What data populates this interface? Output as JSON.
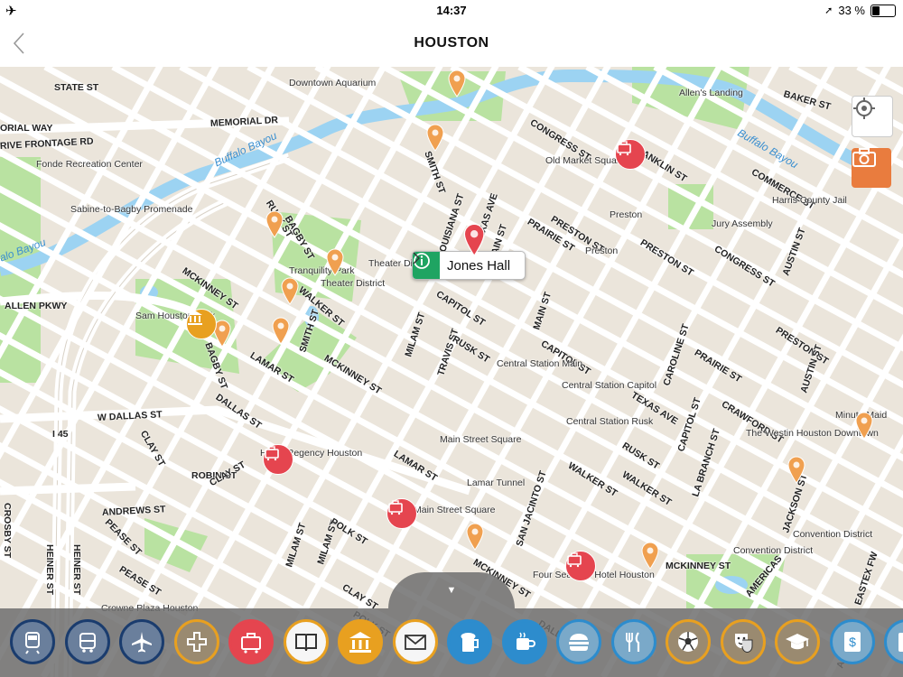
{
  "status_bar": {
    "time": "14:37",
    "battery": "33 %",
    "battery_level": 0.33
  },
  "nav": {
    "title": "HOUSTON",
    "back_icon": "chevron-left-icon"
  },
  "map": {
    "selected_place": "Jones Hall",
    "water_labels": [
      "Buffalo Bayou",
      "Buffalo Bayou",
      "alo Bayou"
    ],
    "street_labels": [
      "STATE ST",
      "MEMORIAL DR",
      "ORIAL WAY",
      "RIVE FRONTAGE RD",
      "RUSK ST",
      "BAGBY ST",
      "MCKINNEY ST",
      "WALKER ST",
      "ALLEN PKWY",
      "BAGBY ST",
      "LAMAR ST",
      "DALLAS ST",
      "SMITH ST",
      "MCKINNEY ST",
      "W DALLAS ST",
      "I 45",
      "CLAY ST",
      "ROBIN ST",
      "CLAY ST",
      "PEASE ST",
      "ANDREWS ST",
      "CROSBY ST",
      "HEINER ST",
      "HEINER ST",
      "PEASE ST",
      "MILAM ST",
      "MILAM ST",
      "POLK ST",
      "LAMAR ST",
      "MCKINNEY ST",
      "MILAM ST",
      "TRAVIS ST",
      "RUSK ST",
      "CAPITOL ST",
      "TEXAS AVE",
      "LOUISIANA ST",
      "SMITH ST",
      "MAIN ST",
      "MAIN ST",
      "PRAIRIE ST",
      "PRESTON ST",
      "CONGRESS ST",
      "FRANKLIN ST",
      "BAKER ST",
      "COMMERCE ST",
      "PRESTON ST",
      "CONGRESS ST",
      "AUSTIN ST",
      "PRAIRIE ST",
      "CAPITOL ST",
      "CAROLINE ST",
      "TEXAS AVE",
      "CRAWFORD ST",
      "PRESTON ST",
      "AUSTIN ST",
      "CAPITOL ST",
      "RUSK ST",
      "LA BRANCH ST",
      "WALKER ST",
      "WALKER ST",
      "SAN JACINTO ST",
      "JACKSON ST",
      "MCKINNEY ST",
      "DALLAS ST",
      "CLAY ST",
      "POLK ST",
      "AMERICAS",
      "EASTEX FW",
      "ARTRES"
    ],
    "poi_labels": [
      "Downtown Aquarium",
      "Fonde Recreation Center",
      "Sabine-to-Bagby Promenade",
      "Tranquility Park",
      "Theater District",
      "Theater District",
      "Sam Houston Park",
      "Hilton Regency Houston",
      "Lamar Tunnel",
      "Main Street Square",
      "Central Station Main",
      "Central Station Capitol",
      "Central Station Rusk",
      "Main Street Square",
      "Four Seasons Hotel Houston",
      "Crowne Plaza Houston",
      "Old Market Square",
      "Allen's Landing",
      "Harris County Jail",
      "Jury Assembly",
      "Preston",
      "Preston",
      "The Westin Houston Downtown",
      "Minute Maid",
      "Convention District",
      "Convention District"
    ]
  },
  "buttons": {
    "locate_icon": "crosshair-icon",
    "camera_icon": "camera-icon",
    "expand_icon": "triangle-down-icon"
  },
  "categories": [
    {
      "name": "train",
      "icon": "train-icon",
      "color": "#1a3c6e",
      "ring": "#1a3c6e"
    },
    {
      "name": "bus",
      "icon": "bus-icon",
      "color": "#1a3c6e",
      "ring": "#1a3c6e"
    },
    {
      "name": "airport",
      "icon": "plane-icon",
      "color": "#1a3c6e",
      "ring": "#1a3c6e"
    },
    {
      "name": "health",
      "icon": "medical-cross-icon",
      "color": "#e8a020",
      "ring": "#e8a020"
    },
    {
      "name": "hotels",
      "icon": "luggage-icon",
      "color": "#e5454f",
      "ring": "#e5454f"
    },
    {
      "name": "books",
      "icon": "book-icon",
      "color": "#e8a020",
      "ring": "#e8a020"
    },
    {
      "name": "museums",
      "icon": "museum-icon",
      "color": "#e8a020",
      "ring": "#e8a020"
    },
    {
      "name": "mail",
      "icon": "envelope-icon",
      "color": "#e8a020",
      "ring": "#e8a020"
    },
    {
      "name": "bars",
      "icon": "beer-mug-icon",
      "color": "#2d8ccd",
      "ring": "#2d8ccd"
    },
    {
      "name": "cafes",
      "icon": "coffee-cup-icon",
      "color": "#2d8ccd",
      "ring": "#2d8ccd"
    },
    {
      "name": "fast-food",
      "icon": "burger-icon",
      "color": "#2d8ccd",
      "ring": "#2d8ccd"
    },
    {
      "name": "restaurants",
      "icon": "fork-knife-icon",
      "color": "#2d8ccd",
      "ring": "#2d8ccd"
    },
    {
      "name": "sports",
      "icon": "soccer-ball-icon",
      "color": "#e8a020",
      "ring": "#e8a020"
    },
    {
      "name": "theater",
      "icon": "theater-mask-icon",
      "color": "#e8a020",
      "ring": "#e8a020"
    },
    {
      "name": "education",
      "icon": "graduation-cap-icon",
      "color": "#e8a020",
      "ring": "#e8a020"
    },
    {
      "name": "money",
      "icon": "money-icon",
      "color": "#2d8ccd",
      "ring": "#2d8ccd"
    },
    {
      "name": "shopping",
      "icon": "shopping-icon",
      "color": "#2d8ccd",
      "ring": "#2d8ccd"
    }
  ],
  "colors": {
    "orange_pin": "#f0a050",
    "red_pin": "#e5454f",
    "green_info": "#1fa462",
    "water": "#9cd3f2",
    "park": "#b9e2a1"
  }
}
